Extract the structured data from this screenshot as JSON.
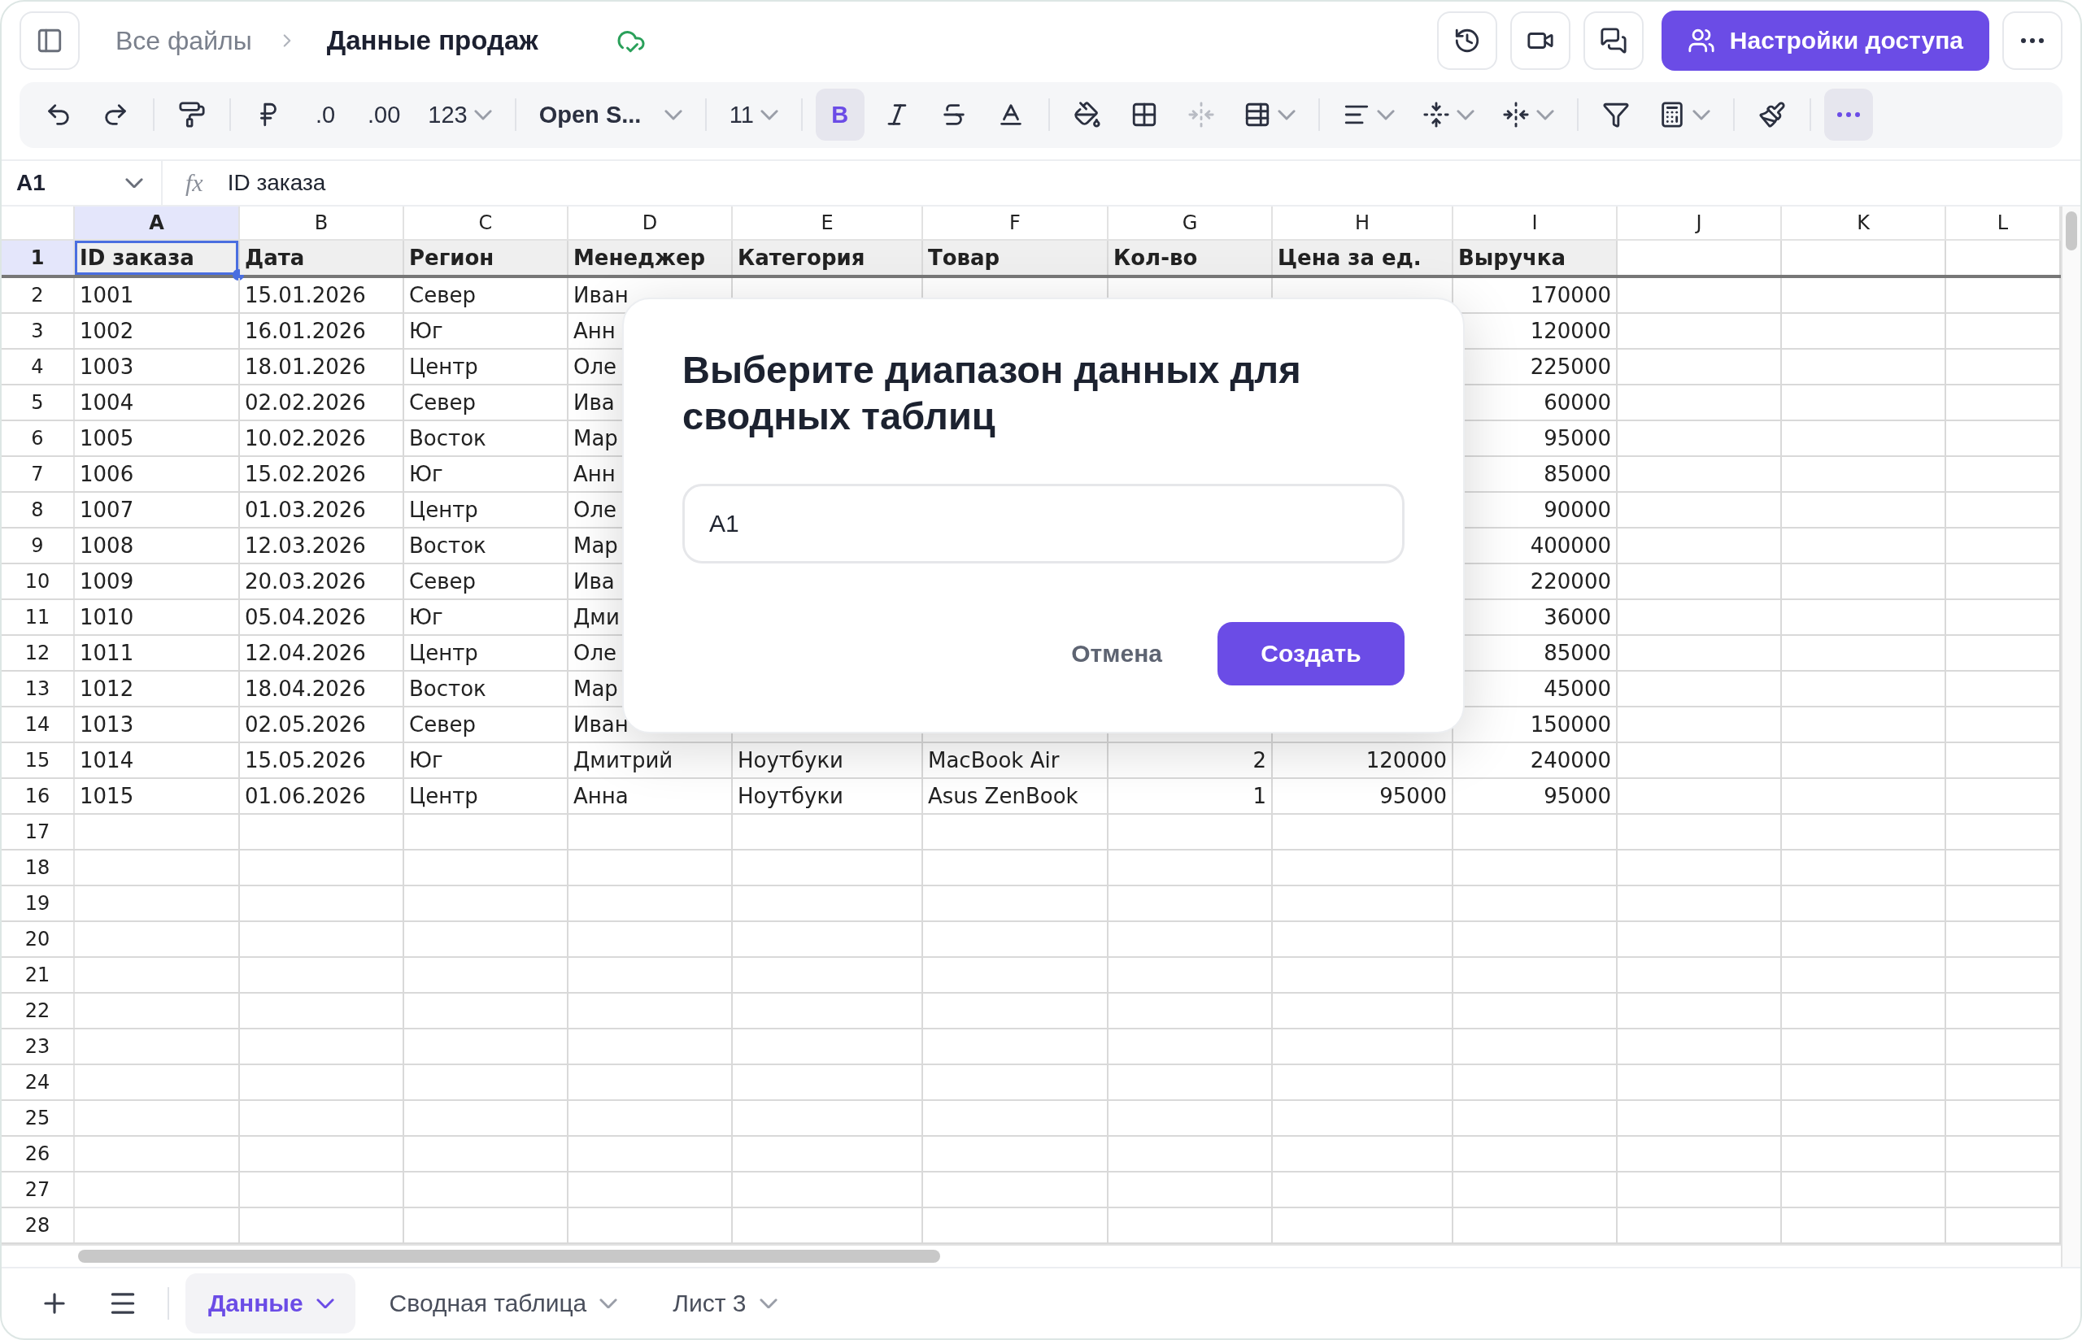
{
  "topbar": {
    "breadcrumb_parent": "Все файлы",
    "file_title": "Данные продаж",
    "share_button": "Настройки доступа"
  },
  "toolbar": {
    "decimal_buttons": [
      ".0",
      ".00"
    ],
    "number_format": "123",
    "font": "Open S...",
    "font_size": "11",
    "bold": {
      "label": "B",
      "on": true
    }
  },
  "formula_bar": {
    "cell_ref": "A1",
    "fx": "fx",
    "value": "ID заказа"
  },
  "sheet": {
    "columns": [
      {
        "label": "A",
        "selected": true,
        "numeric": false
      },
      {
        "label": "B",
        "selected": false,
        "numeric": false
      },
      {
        "label": "C",
        "selected": false,
        "numeric": false
      },
      {
        "label": "D",
        "selected": false,
        "numeric": false
      },
      {
        "label": "E",
        "selected": false,
        "numeric": false
      },
      {
        "label": "F",
        "selected": false,
        "numeric": false
      },
      {
        "label": "G",
        "selected": false,
        "numeric": true
      },
      {
        "label": "H",
        "selected": false,
        "numeric": true
      },
      {
        "label": "I",
        "selected": false,
        "numeric": true
      },
      {
        "label": "J",
        "selected": false
      },
      {
        "label": "K",
        "selected": false
      },
      {
        "label": "L",
        "selected": false
      }
    ],
    "rows": [
      {
        "number": "1",
        "selected": true,
        "kind": "header",
        "cells": [
          "ID заказа",
          "Дата",
          "Регион",
          "Менеджер",
          "Категория",
          "Товар",
          "Кол-во",
          "Цена за ед.",
          "Выручка"
        ]
      },
      {
        "number": "2",
        "selected": false,
        "kind": "data",
        "cells": [
          "1001",
          "15.01.2026",
          "Север",
          "Иван",
          null,
          null,
          null,
          null,
          "170000"
        ]
      },
      {
        "number": "3",
        "selected": false,
        "kind": "data",
        "cells": [
          "1002",
          "16.01.2026",
          "Юг",
          "Анн",
          null,
          null,
          null,
          null,
          "120000"
        ]
      },
      {
        "number": "4",
        "selected": false,
        "kind": "data",
        "cells": [
          "1003",
          "18.01.2026",
          "Центр",
          "Оле",
          null,
          null,
          null,
          null,
          "225000"
        ]
      },
      {
        "number": "5",
        "selected": false,
        "kind": "data",
        "cells": [
          "1004",
          "02.02.2026",
          "Север",
          "Ива",
          null,
          null,
          null,
          null,
          "60000"
        ]
      },
      {
        "number": "6",
        "selected": false,
        "kind": "data",
        "cells": [
          "1005",
          "10.02.2026",
          "Восток",
          "Мар",
          null,
          null,
          null,
          null,
          "95000"
        ]
      },
      {
        "number": "7",
        "selected": false,
        "kind": "data",
        "cells": [
          "1006",
          "15.02.2026",
          "Юг",
          "Анн",
          null,
          null,
          null,
          null,
          "85000"
        ]
      },
      {
        "number": "8",
        "selected": false,
        "kind": "data",
        "cells": [
          "1007",
          "01.03.2026",
          "Центр",
          "Оле",
          null,
          null,
          null,
          null,
          "90000"
        ]
      },
      {
        "number": "9",
        "selected": false,
        "kind": "data",
        "cells": [
          "1008",
          "12.03.2026",
          "Восток",
          "Мар",
          null,
          null,
          null,
          null,
          "400000"
        ]
      },
      {
        "number": "10",
        "selected": false,
        "kind": "data",
        "cells": [
          "1009",
          "20.03.2026",
          "Север",
          "Ива",
          null,
          null,
          null,
          null,
          "220000"
        ]
      },
      {
        "number": "11",
        "selected": false,
        "kind": "data",
        "cells": [
          "1010",
          "05.04.2026",
          "Юг",
          "Дми",
          null,
          null,
          null,
          null,
          "36000"
        ]
      },
      {
        "number": "12",
        "selected": false,
        "kind": "data",
        "cells": [
          "1011",
          "12.04.2026",
          "Центр",
          "Оле",
          null,
          null,
          null,
          null,
          "85000"
        ]
      },
      {
        "number": "13",
        "selected": false,
        "kind": "data",
        "cells": [
          "1012",
          "18.04.2026",
          "Восток",
          "Мар",
          null,
          null,
          null,
          null,
          "45000"
        ]
      },
      {
        "number": "14",
        "selected": false,
        "kind": "data",
        "cells": [
          "1013",
          "02.05.2026",
          "Север",
          "Иван",
          null,
          null,
          null,
          null,
          "150000"
        ]
      },
      {
        "number": "15",
        "selected": false,
        "kind": "data",
        "cells": [
          "1014",
          "15.05.2026",
          "Юг",
          "Дмитрий",
          "Ноутбуки",
          "MacBook Air",
          "2",
          "120000",
          "240000"
        ]
      },
      {
        "number": "16",
        "selected": false,
        "kind": "data",
        "cells": [
          "1015",
          "01.06.2026",
          "Центр",
          "Анна",
          "Ноутбуки",
          "Asus ZenBook",
          "1",
          "95000",
          "95000"
        ]
      },
      {
        "number": "17",
        "selected": false,
        "kind": "data",
        "cells": []
      },
      {
        "number": "18",
        "selected": false,
        "kind": "data",
        "cells": []
      },
      {
        "number": "19",
        "selected": false,
        "kind": "data",
        "cells": []
      },
      {
        "number": "20",
        "selected": false,
        "kind": "data",
        "cells": []
      },
      {
        "number": "21",
        "selected": false,
        "kind": "data",
        "cells": []
      },
      {
        "number": "22",
        "selected": false,
        "kind": "data",
        "cells": []
      },
      {
        "number": "23",
        "selected": false,
        "kind": "data",
        "cells": []
      },
      {
        "number": "24",
        "selected": false,
        "kind": "data",
        "cells": []
      },
      {
        "number": "25",
        "selected": false,
        "kind": "data",
        "cells": []
      },
      {
        "number": "26",
        "selected": false,
        "kind": "data",
        "cells": []
      },
      {
        "number": "27",
        "selected": false,
        "kind": "data",
        "cells": []
      },
      {
        "number": "28",
        "selected": false,
        "kind": "data",
        "cells": []
      }
    ]
  },
  "dialog": {
    "title": "Выберите диапазон данных для сводных таблиц",
    "range_value": "A1",
    "cancel_button": "Отмена",
    "create_button": "Создать"
  },
  "sheet_tabs": [
    {
      "label": "Данные",
      "selected": true
    },
    {
      "label": "Сводная таблица",
      "selected": false
    },
    {
      "label": "Лист 3",
      "selected": false
    }
  ]
}
